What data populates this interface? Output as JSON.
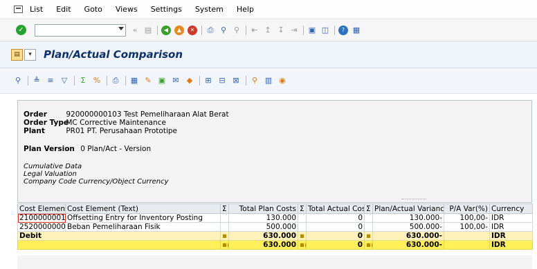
{
  "menu": {
    "items": [
      "List",
      "Edit",
      "Goto",
      "Views",
      "Settings",
      "System",
      "Help"
    ]
  },
  "toolbar": {
    "command_value": "",
    "icons": [
      "enter-icon",
      "back-arrows-icon",
      "save-icon",
      "back-icon",
      "exit-icon",
      "cancel-icon",
      "print-icon",
      "find-icon",
      "find-next-icon",
      "first-page-icon",
      "prev-page-icon",
      "next-page-icon",
      "last-page-icon",
      "new-session-icon",
      "shortcut-icon",
      "help-icon",
      "customize-icon"
    ]
  },
  "title": {
    "text": "Plan/Actual Comparison"
  },
  "header": {
    "order_label": "Order",
    "order_value": "920000000103 Test Pemeliharaan Alat Berat",
    "order_type_label": "Order Type",
    "order_type_value": "MC Corrective Maintenance",
    "plant_label": "Plant",
    "plant_value": "PR01 PT. Perusahaan Prototipe",
    "plan_version_label": "Plan Version",
    "plan_version_value": "0 Plan/Act - Version",
    "note1": "Cumulative Data",
    "note2": "Legal Valuation",
    "note3": "Company Code Currency/Object Currency"
  },
  "grid": {
    "columns": {
      "cost_element": "Cost Element",
      "cost_element_text": "Cost Element (Text)",
      "sigma1": "Σ",
      "total_plan": "Total Plan Costs",
      "sigma2": "Σ",
      "total_actual": "Total Actual Costs",
      "sigma3": "Σ",
      "variance": "Plan/Actual Variance",
      "pa_var": "P/A Var(%)",
      "currency": "Currency"
    },
    "rows": [
      {
        "cost_element": "2100000001",
        "text": "Offsetting Entry for Inventory Posting",
        "plan": "130.000",
        "actual": "0",
        "variance": "130.000-",
        "pct": "100,00-",
        "currency": "IDR"
      },
      {
        "cost_element": "2520000000",
        "text": "Beban Pemeliharaan Fisik",
        "plan": "500.000",
        "actual": "0",
        "variance": "500.000-",
        "pct": "100,00-",
        "currency": "IDR"
      }
    ],
    "subtotal": {
      "label": "Debit",
      "mark1": "▪",
      "plan": "630.000",
      "mark2": "▪",
      "actual": "0",
      "mark3": "▪",
      "variance": "630.000-",
      "currency": "IDR"
    },
    "total": {
      "mark1": "▪▪",
      "plan": "630.000",
      "mark2": "▪▪",
      "actual": "0",
      "mark3": "▪▪",
      "variance": "630.000-",
      "currency": "IDR"
    }
  }
}
